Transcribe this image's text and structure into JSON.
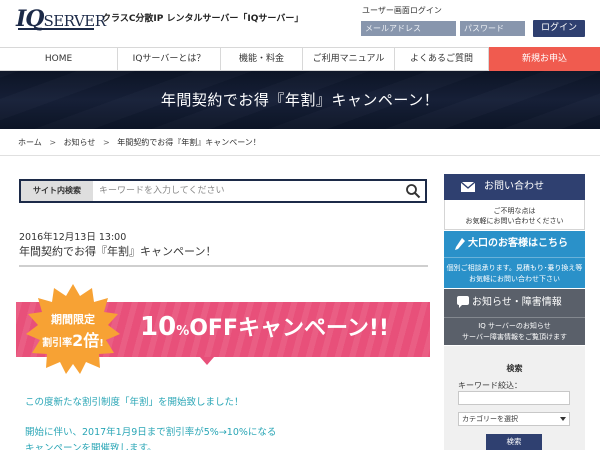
{
  "header": {
    "logo_iq": "IQ",
    "logo_server": "SERVER",
    "tagline": "クラスC分散IP レンタルサーバー「IQサーバー」",
    "login_title": "ユーザー画面ログイン",
    "email_placeholder": "メールアドレス",
    "password_placeholder": "パスワード",
    "login_button": "ログイン"
  },
  "nav": {
    "items": [
      "HOME",
      "IQサーバーとは？",
      "機能・料金",
      "ご利用マニュアル",
      "よくあるご質問"
    ],
    "cta": "新規お申込"
  },
  "banner": {
    "title": "年間契約でお得『年割』キャンペーン！"
  },
  "breadcrumb": {
    "items": [
      "ホーム",
      "お知らせ",
      "年間契約でお得『年割』キャンペーン！"
    ]
  },
  "search": {
    "label": "サイト内検索",
    "placeholder": "キーワードを入力してください"
  },
  "post": {
    "date": "2016年12月13日 13:00",
    "title": "年間契約でお得『年割』キャンペーン！",
    "campaign_badge_line1": "期間限定",
    "campaign_badge_line2_pre": "割引率",
    "campaign_badge_line2_big": "2倍",
    "campaign_badge_line2_post": "!",
    "campaign_pct": "10",
    "campaign_unit": "%",
    "campaign_rest": "OFFキャンペーン!!",
    "body_line1": "この度新たな割引制度「年割」を開始致しました！",
    "body_line2": "開始に伴い、2017年1月9日まで割引率が5%→10%になる",
    "body_line3": "キャンペーンを開催致します。"
  },
  "sidebar": {
    "contact_title": "お問い合わせ",
    "contact_line1": "ご不明な点は",
    "contact_line2": "お気軽にお問い合わせください",
    "large_title": "大口のお客様はこちら",
    "large_line1": "個別ご相談承ります。見積もり･乗り換え等",
    "large_line2": "お気軽にお問い合わせ下さい",
    "news_title": "お知らせ・障害情報",
    "news_line1": "IQ サーバーのお知らせ",
    "news_line2": "サーバー障害情報をご覧頂けます",
    "search_title": "検索",
    "keyword_label": "キーワード絞込：",
    "category_select": "カテゴリーを選択",
    "search_button": "検索"
  },
  "colors": {
    "navy": "#2f4070",
    "cta_red": "#f05b4f",
    "campaign_pink": "#e8507a",
    "badge_orange": "#f7a234",
    "sidebar_blue": "#2a91c9",
    "sidebar_gray": "#5a606a",
    "text_teal": "#2aa6b6"
  }
}
